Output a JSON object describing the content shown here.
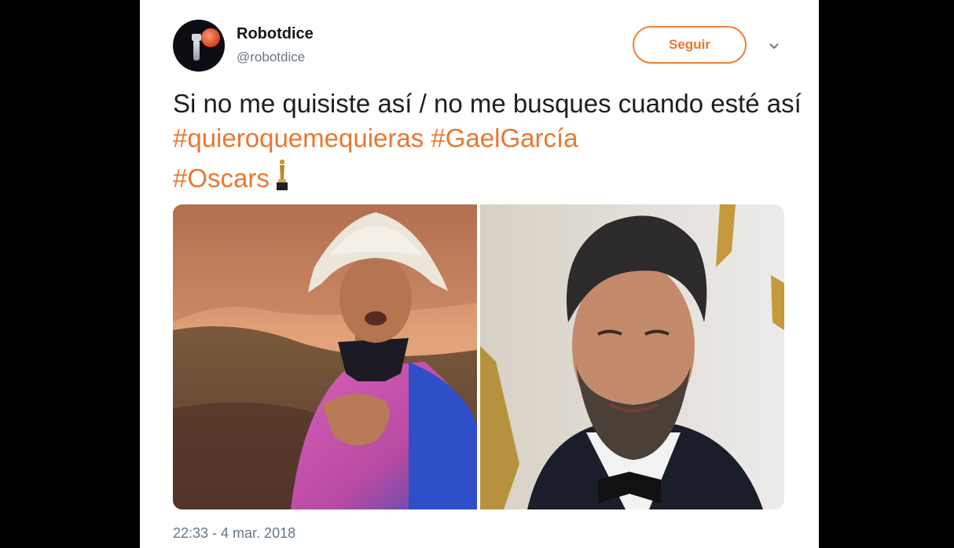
{
  "tweet": {
    "author_name": "Robotdice",
    "author_handle": "@robotdice",
    "follow_label": "Seguir",
    "text_plain_1": "Si no me quisiste así / no me busques cuando esté así ",
    "hashtags": [
      "#quieroquemequieras",
      "#GaelGarcía",
      "#Oscars"
    ],
    "timestamp": "22:33 - 4 mar. 2018"
  },
  "icons": {
    "follow_menu": "chevron-down-icon",
    "emoji": "oscar-trophy-icon"
  },
  "colors": {
    "accent": "#e8782f",
    "text": "#1c1e21",
    "muted": "#657786"
  }
}
